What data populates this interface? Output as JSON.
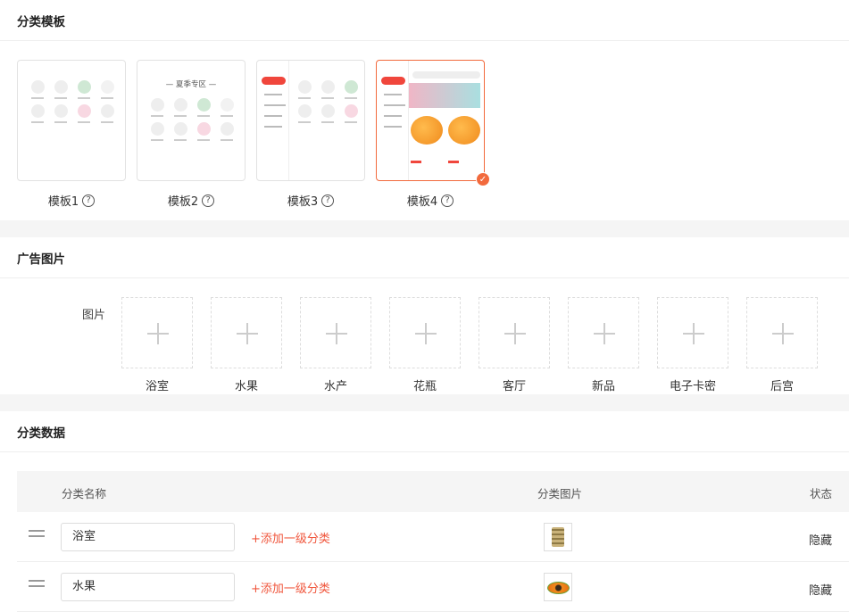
{
  "template_section": {
    "title": "分类模板",
    "templates": [
      {
        "label": "模板1"
      },
      {
        "label": "模板2",
        "inner_title": "— 夏季专区 —"
      },
      {
        "label": "模板3"
      },
      {
        "label": "模板4",
        "selected": true
      }
    ],
    "help_glyph": "?",
    "check_glyph": "✓"
  },
  "ad_section": {
    "title": "广告图片",
    "field_label": "图片",
    "slots": [
      "浴室",
      "水果",
      "水产",
      "花瓶",
      "客厅",
      "新品",
      "电子卡密",
      "后宫"
    ]
  },
  "data_section": {
    "title": "分类数据",
    "columns": {
      "name": "分类名称",
      "image": "分类图片",
      "status": "状态"
    },
    "rows": [
      {
        "name": "浴室",
        "add_link": "+添加一级分类",
        "status": "隐藏",
        "thumb_icon": "basket-thumbnail"
      },
      {
        "name": "水果",
        "add_link": "+添加一级分类",
        "status": "隐藏",
        "thumb_icon": "papaya-thumbnail"
      }
    ]
  },
  "colors": {
    "accent": "#f26a3d",
    "link": "#f0563c"
  }
}
